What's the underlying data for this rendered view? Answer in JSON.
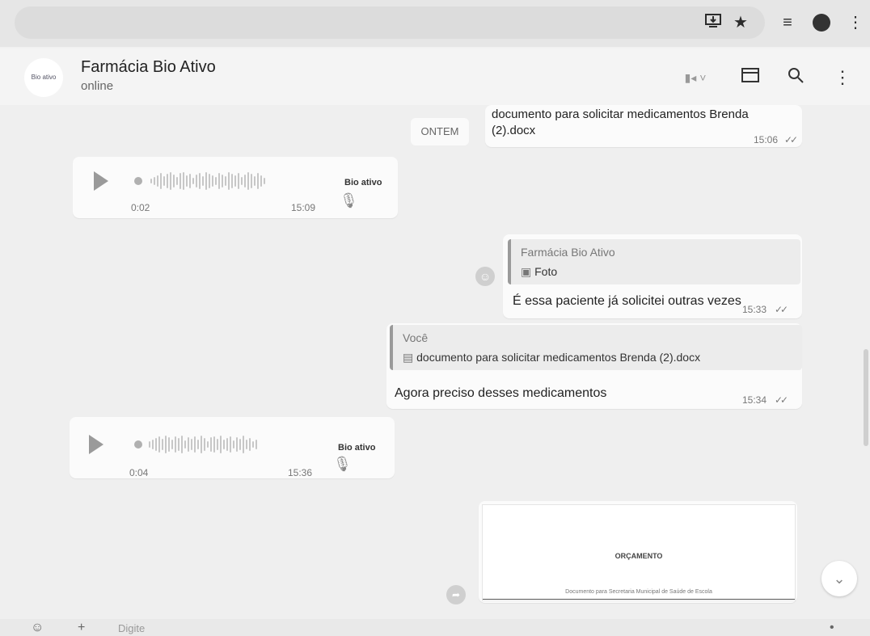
{
  "browser": {
    "icons": [
      "install-app-icon",
      "star-icon",
      "media-list-icon",
      "profile-icon",
      "more-vert-icon"
    ]
  },
  "header": {
    "avatar_text": "Bio ativo",
    "contact_name": "Farmácia Bio Ativo",
    "status": "online",
    "icons": [
      "video-call-icon",
      "catalog-icon",
      "search-icon",
      "more-vert-icon"
    ]
  },
  "chat": {
    "date_divider": "ONTEM",
    "doc_msg": {
      "text": "documento para solicitar medicamentos Brenda (2).docx",
      "time": "15:06",
      "ticks": "✓✓"
    },
    "audio1": {
      "duration": "0:02",
      "time": "15:09",
      "brand": "Bio ativo"
    },
    "reply1": {
      "quote_author": "Farmácia Bio Ativo",
      "quote_icon": "camera-icon",
      "quote_text": "Foto",
      "text": "É essa paciente já solicitei outras vezes",
      "time": "15:33",
      "ticks": "✓✓"
    },
    "reply2": {
      "quote_author": "Você",
      "quote_icon": "document-icon",
      "quote_text": "documento para solicitar medicamentos Brenda (2).docx",
      "text": "Agora preciso desses medicamentos",
      "time": "15:34",
      "ticks": "✓✓"
    },
    "audio2": {
      "duration": "0:04",
      "time": "15:36",
      "brand": "Bio ativo"
    },
    "doc_preview": {
      "heading": "ORÇAMENTO",
      "caption": "Documento para Secretaria Municipal de Saúde de Escola"
    },
    "scroll_down_icon": "chevron-down-icon"
  },
  "composer": {
    "placeholder": "Digite"
  }
}
